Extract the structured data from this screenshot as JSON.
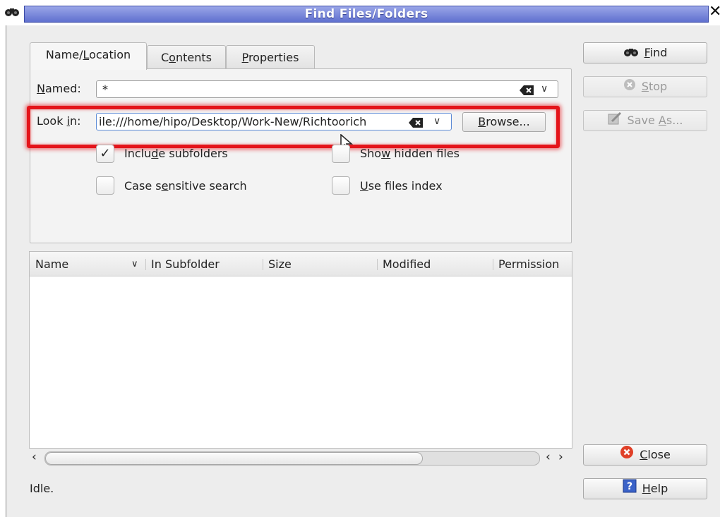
{
  "window": {
    "title": "Find Files/Folders"
  },
  "tabs": [
    {
      "label_pre": "Name/",
      "label_key": "L",
      "label_post": "ocation"
    },
    {
      "label_pre": "C",
      "label_key": "o",
      "label_post": "ntents"
    },
    {
      "label_pre": "",
      "label_key": "P",
      "label_post": "roperties"
    }
  ],
  "named": {
    "label_key": "N",
    "label_post": "amed:",
    "value": "*"
  },
  "look_in": {
    "label_pre": "Look ",
    "label_key": "i",
    "label_post": "n:",
    "value": "ile:///home/hipo/Desktop/Work-New/Richtoorich"
  },
  "browse": {
    "label_key": "B",
    "label_post": "rowse..."
  },
  "options": {
    "include_subfolders": {
      "pre": "Inclu",
      "key": "d",
      "post": "e subfolders",
      "checked": true
    },
    "case_sensitive": {
      "pre": "Case s",
      "key": "e",
      "post": "nsitive search",
      "checked": false
    },
    "show_hidden": {
      "pre": "Sho",
      "key": "w",
      "post": " hidden files",
      "checked": false
    },
    "use_index": {
      "pre": "",
      "key": "U",
      "post": "se files index",
      "checked": false
    }
  },
  "results": {
    "columns": [
      "Name",
      "In Subfolder",
      "Size",
      "Modified",
      "Permission"
    ]
  },
  "actions": {
    "find": {
      "key": "F",
      "post": "ind"
    },
    "stop": {
      "key": "S",
      "post": "top"
    },
    "save_as": {
      "pre": "Save ",
      "key": "A",
      "post": "s..."
    },
    "close": {
      "key": "C",
      "post": "lose"
    },
    "help": {
      "key": "H",
      "post": "elp"
    }
  },
  "status": "Idle.",
  "colors": {
    "titlebar": "#6070cf",
    "highlight": "#e4141a",
    "close_icon": "#e04028",
    "help_icon": "#3a62c8"
  }
}
